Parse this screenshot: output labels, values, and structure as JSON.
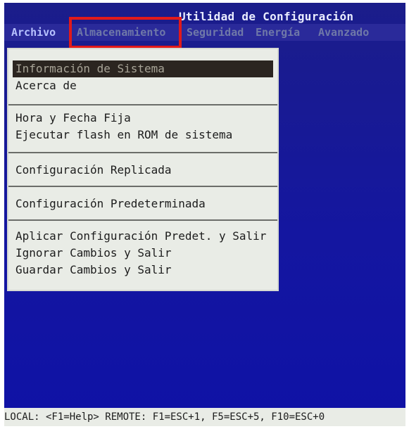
{
  "window": {
    "title": "Utilidad de Configuración"
  },
  "menubar": {
    "items": [
      {
        "label": "Archivo"
      },
      {
        "label": "Almacenamiento"
      },
      {
        "label": "Seguridad"
      },
      {
        "label": "Energía"
      },
      {
        "label": "Avanzado"
      }
    ]
  },
  "dropdown": {
    "items": [
      {
        "label": "Información de Sistema"
      },
      {
        "label": "Acerca de"
      },
      {
        "label": "Hora y Fecha Fija"
      },
      {
        "label": "Ejecutar flash en ROM de sistema"
      },
      {
        "label": "Configuración Replicada"
      },
      {
        "label": "Configuración Predeterminada"
      },
      {
        "label": "Aplicar Configuración Predet. y Salir"
      },
      {
        "label": "Ignorar Cambios y Salir"
      },
      {
        "label": "Guardar Cambios y Salir"
      }
    ]
  },
  "statusbar": {
    "text": "LOCAL: <F1=Help> REMOTE: F1=ESC+1, F5=ESC+5, F10=ESC+0"
  },
  "colors": {
    "screen_bg": "#1416a0",
    "highlight_border": "#e21a1a",
    "menu_panel_bg": "#e9ece6",
    "selected_item_bg": "#2b2520"
  }
}
